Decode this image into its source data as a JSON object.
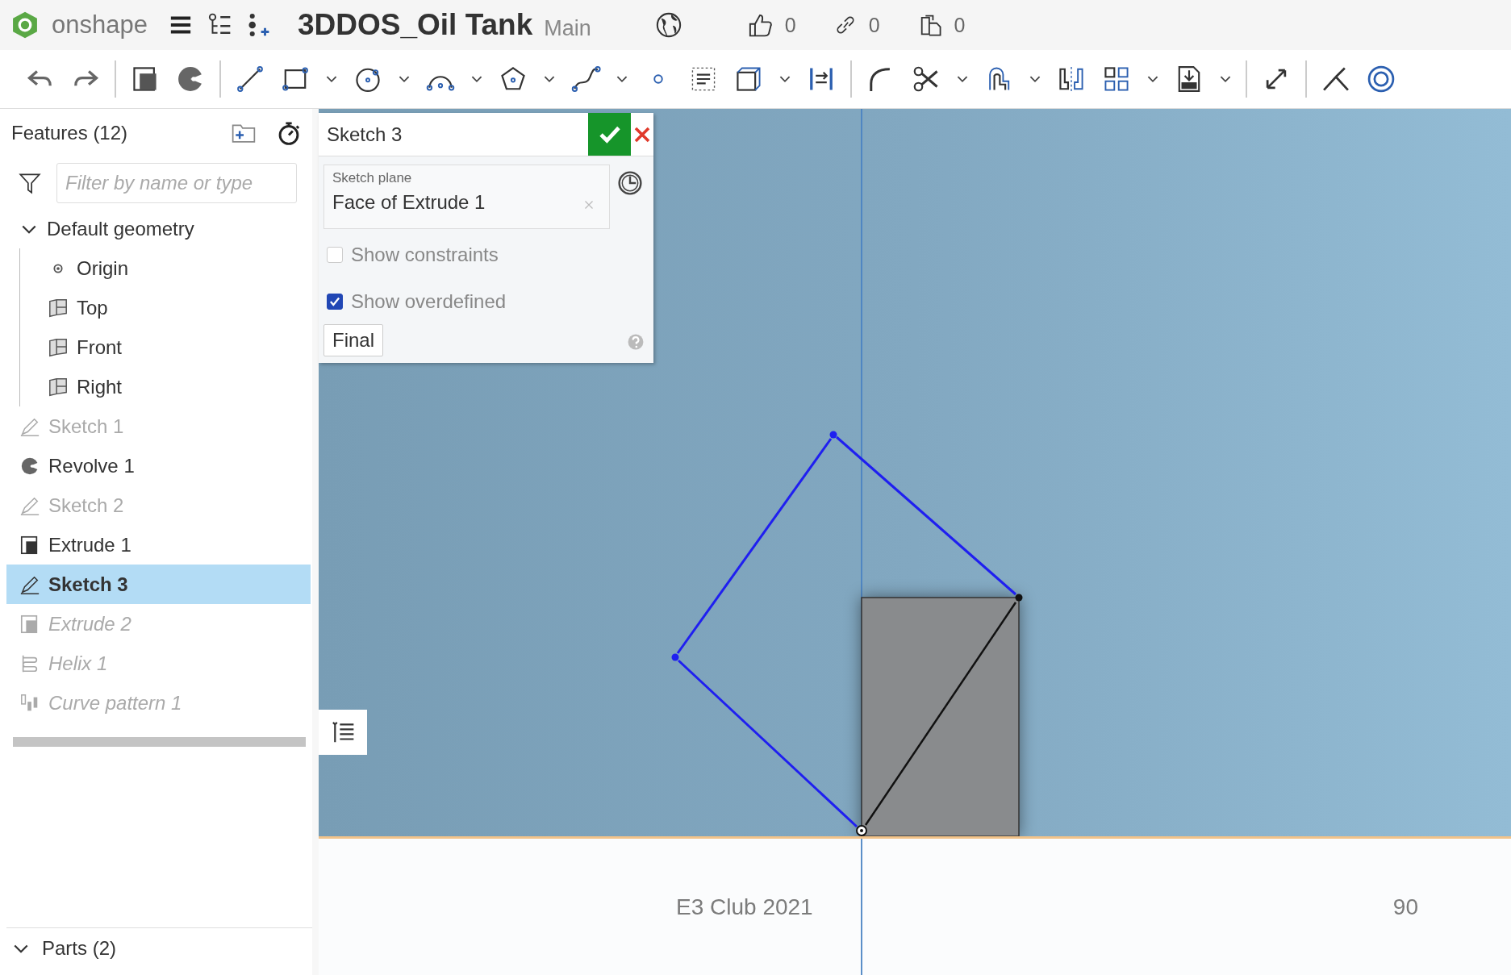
{
  "header": {
    "app_name": "onshape",
    "document_title": "3DDOS_Oil Tank",
    "workspace": "Main",
    "like_count": "0",
    "link_count": "0",
    "copy_count": "0"
  },
  "feature_list": {
    "title": "Features (12)",
    "filter": {
      "placeholder": "Filter by name or type"
    },
    "items": [
      {
        "kind": "group",
        "label": "Default geometry",
        "expanded": true,
        "selected": false,
        "hidden": false,
        "rolled_back": false,
        "children": [
          {
            "kind": "origin",
            "label": "Origin",
            "selected": false,
            "hidden": false,
            "rolled_back": false
          },
          {
            "kind": "plane",
            "label": "Top",
            "selected": false,
            "hidden": false,
            "rolled_back": false
          },
          {
            "kind": "plane",
            "label": "Front",
            "selected": false,
            "hidden": false,
            "rolled_back": false
          },
          {
            "kind": "plane",
            "label": "Right",
            "selected": false,
            "hidden": false,
            "rolled_back": false
          }
        ]
      },
      {
        "kind": "sketch",
        "label": "Sketch 1",
        "selected": false,
        "hidden": true,
        "rolled_back": false
      },
      {
        "kind": "revolve",
        "label": "Revolve 1",
        "selected": false,
        "hidden": false,
        "rolled_back": false
      },
      {
        "kind": "sketch",
        "label": "Sketch 2",
        "selected": false,
        "hidden": true,
        "rolled_back": false
      },
      {
        "kind": "extrude",
        "label": "Extrude 1",
        "selected": false,
        "hidden": false,
        "rolled_back": false
      },
      {
        "kind": "sketch",
        "label": "Sketch 3",
        "selected": true,
        "hidden": false,
        "rolled_back": false
      },
      {
        "kind": "extrude",
        "label": "Extrude 2",
        "selected": false,
        "hidden": false,
        "rolled_back": true
      },
      {
        "kind": "helix",
        "label": "Helix 1",
        "selected": false,
        "hidden": false,
        "rolled_back": true
      },
      {
        "kind": "curve_pattern",
        "label": "Curve pattern 1",
        "selected": false,
        "hidden": false,
        "rolled_back": true
      }
    ],
    "parts": {
      "label": "Parts (2)",
      "expanded": true
    }
  },
  "sketch_dialog": {
    "title": "Sketch 3",
    "plane_label": "Sketch plane",
    "plane_value": "Face of Extrude 1",
    "options": [
      {
        "label": "Show constraints",
        "checked": false
      },
      {
        "label": "Show overdefined",
        "checked": true
      }
    ],
    "final_button": "Final"
  },
  "slide_footer": {
    "text": "E3 Club 2021",
    "page": "90"
  }
}
